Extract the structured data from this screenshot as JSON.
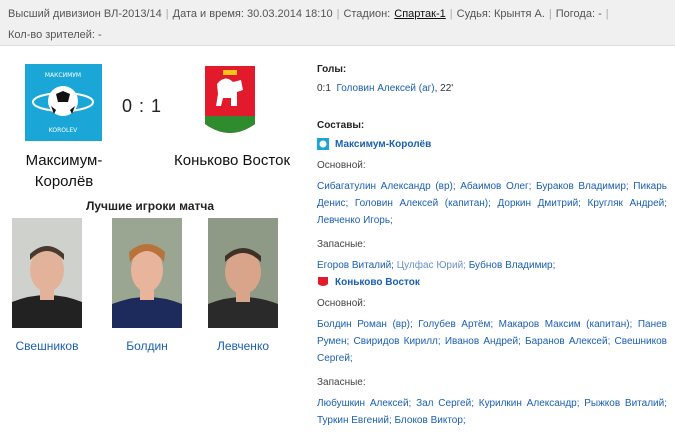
{
  "match_info": {
    "division": "Высший дивизион ВЛ-2013/14",
    "datetime": "Дата и время: 30.03.2014 18:10",
    "stadium_label": "Стадион:",
    "stadium_link": "Спартак-1",
    "referee": "Судья: Крынтя А.",
    "weather": "Погода: -",
    "attendance": "Кол-во зрителей: -"
  },
  "home": {
    "name": "Максимум-Королёв",
    "name_line1": "Максимум-",
    "name_line2": "Королёв",
    "logo_text_top": "МАКСИМУМ",
    "logo_text_bottom": "KOROLEV"
  },
  "away": {
    "name": "Коньково Восток"
  },
  "score": "0 : 1",
  "best_players_title": "Лучшие игроки матча",
  "best_players": [
    {
      "name": "Свешников"
    },
    {
      "name": "Болдин"
    },
    {
      "name": "Левченко"
    }
  ],
  "goals": {
    "title": "Голы:",
    "items": [
      {
        "score": "0:1",
        "player": "Головин Алексей (аг)",
        "minute": ", 22'"
      }
    ]
  },
  "lineups": {
    "title": "Составы:",
    "main_label": "Основной:",
    "subs_label": "Запасные:",
    "home": {
      "team": "Максимум-Королёв",
      "main": "Сибагатулин Александр (вр);  Абаимов Олег;  Бураков Владимир;  Пикарь Денис;  Головин Алексей (капитан);  Доркин Дмитрий;  Кругляк Андрей;  Левченко Игорь;",
      "subs_a": "Егоров Виталий;",
      "subs_b": "Цулфас Юрий;",
      "subs_c": "Бубнов Владимир;"
    },
    "away": {
      "team": "Коньково Восток",
      "main": "Болдин Роман (вр);  Голубев Артём;  Макаров Максим (капитан);  Панев Румен;  Свиридов Кирилл;  Иванов Андрей;  Баранов Алексей;  Свешников Сергей;",
      "subs": "Любушкин Алексей;  Зал Сергей;  Курилкин Александр;  Рыжков Виталий;  Туркин Евгений;  Блоков Виктор;"
    }
  },
  "colors": {
    "link": "#1a5fb4",
    "topbar_bg": "#f0f0f0",
    "home_logo_bg": "#1aa7d8",
    "away_logo_red": "#e21a2c",
    "away_logo_green": "#2e8b2e"
  }
}
